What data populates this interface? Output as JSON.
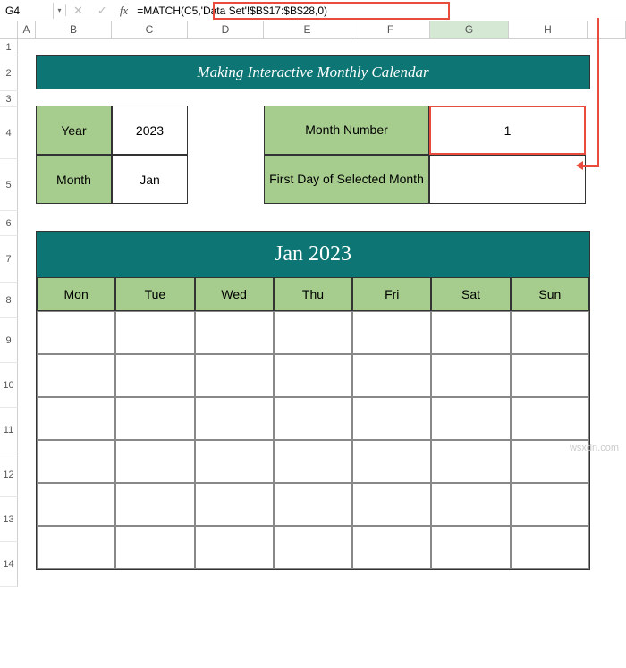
{
  "namebox": {
    "ref": "G4"
  },
  "formula_bar": {
    "fx_label": "fx",
    "formula": "=MATCH(C5,'Data Set'!$B$17:$B$28,0)"
  },
  "columns": [
    "A",
    "B",
    "C",
    "D",
    "E",
    "F",
    "G",
    "H"
  ],
  "rows": [
    "1",
    "2",
    "3",
    "4",
    "5",
    "6",
    "7",
    "8",
    "9",
    "10",
    "11",
    "12",
    "13",
    "14"
  ],
  "title": "Making Interactive Monthly Calendar",
  "params": {
    "year_label": "Year",
    "year_value": "2023",
    "month_label": "Month",
    "month_value": "Jan",
    "month_number_label": "Month Number",
    "month_number_value": "1",
    "first_day_label": "First Day of Selected Month",
    "first_day_value": ""
  },
  "calendar": {
    "title": "Jan 2023",
    "days": [
      "Mon",
      "Tue",
      "Wed",
      "Thu",
      "Fri",
      "Sat",
      "Sun"
    ]
  },
  "watermark": "wsxdn.com",
  "icons": {
    "down": "▾",
    "cancel": "✕",
    "check": "✓"
  }
}
